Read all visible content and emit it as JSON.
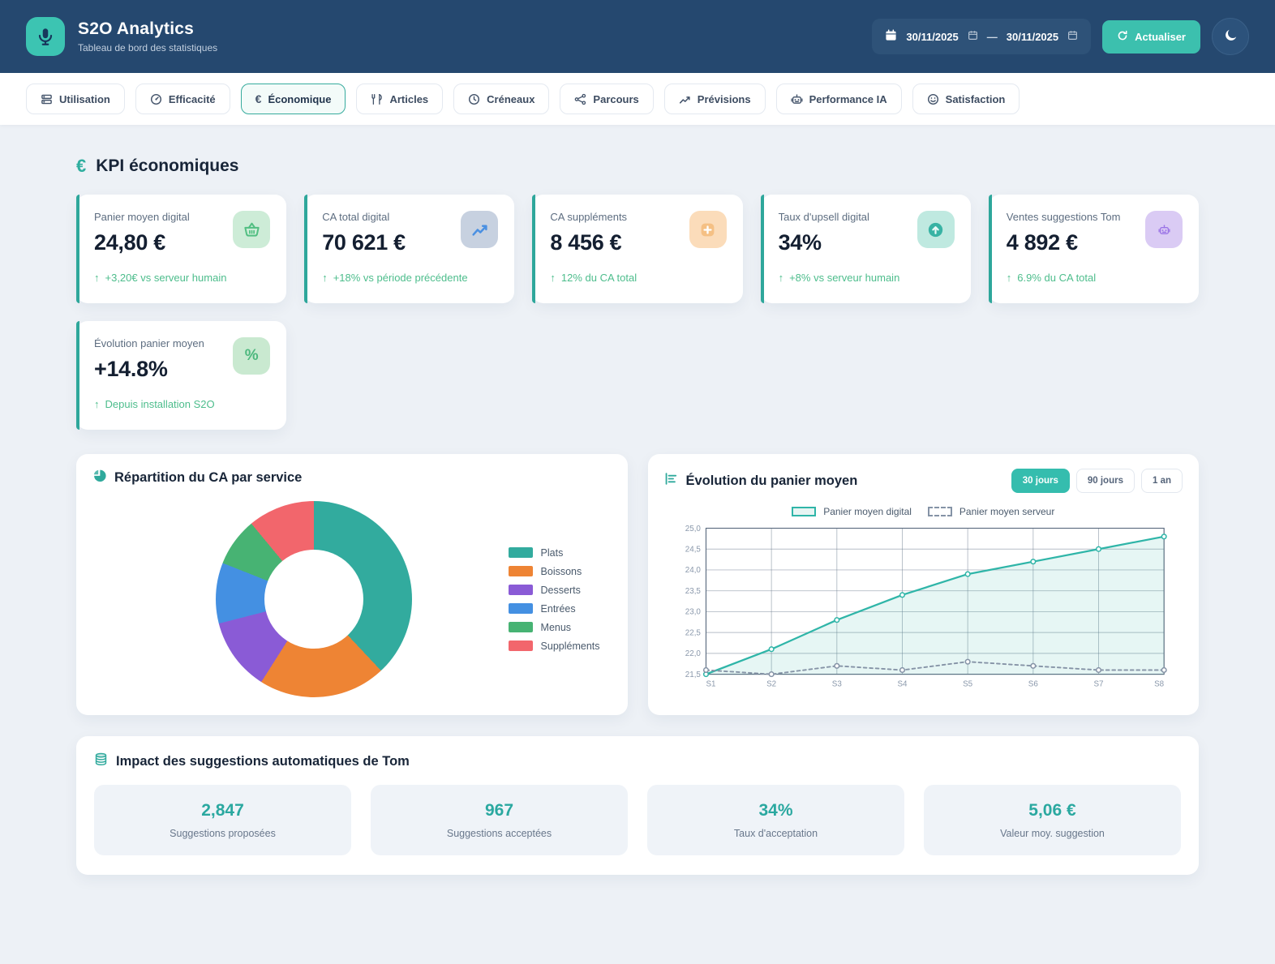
{
  "colors": {
    "accent_teal": "#3cc0ae",
    "header_navy": "#25486f",
    "trend_green": "#4dbd8c",
    "card_stripe": "#2ea79b"
  },
  "header": {
    "app_title": "S2O Analytics",
    "app_subtitle": "Tableau de bord des statistiques",
    "date_from": "30/11/2025",
    "date_separator": "—",
    "date_to": "30/11/2025",
    "refresh_label": "Actualiser"
  },
  "tabs": [
    {
      "label": "Utilisation",
      "icon": "server-icon",
      "active": false
    },
    {
      "label": "Efficacité",
      "icon": "gauge-icon",
      "active": false
    },
    {
      "label": "Économique",
      "icon": "euro-icon",
      "active": true
    },
    {
      "label": "Articles",
      "icon": "utensils-icon",
      "active": false
    },
    {
      "label": "Créneaux",
      "icon": "clock-icon",
      "active": false
    },
    {
      "label": "Parcours",
      "icon": "route-icon",
      "active": false
    },
    {
      "label": "Prévisions",
      "icon": "trend-icon",
      "active": false
    },
    {
      "label": "Performance IA",
      "icon": "robot-icon",
      "active": false
    },
    {
      "label": "Satisfaction",
      "icon": "smiley-icon",
      "active": false
    }
  ],
  "kpi_section": {
    "title": "KPI économiques",
    "cards": [
      {
        "label": "Panier moyen digital",
        "value": "24,80 €",
        "trend": "+3,20€ vs serveur humain",
        "icon": "basket-icon",
        "icon_color": "#52bf82",
        "icon_bg": "#cdecd7"
      },
      {
        "label": "CA total digital",
        "value": "70 621 €",
        "trend": "+18% vs période précédente",
        "icon": "chart-line-icon",
        "icon_color": "#4a90e2",
        "icon_bg": "#c7d1e0"
      },
      {
        "label": "CA suppléments",
        "value": "8 456 €",
        "trend": "12% du CA total",
        "icon": "plus-icon",
        "icon_color": "#f0a44e",
        "icon_bg": "#fbdcba"
      },
      {
        "label": "Taux d'upsell digital",
        "value": "34%",
        "trend": "+8% vs serveur humain",
        "icon": "arrow-up-circle-icon",
        "icon_color": "#38b3a4",
        "icon_bg": "#bfe9e0"
      },
      {
        "label": "Ventes suggestions Tom",
        "value": "4 892 €",
        "trend": "6.9% du CA total",
        "icon": "robot-icon",
        "icon_color": "#9b74e6",
        "icon_bg": "#dacbf4"
      },
      {
        "label": "Évolution panier moyen",
        "value": "+14.8%",
        "trend": "Depuis installation S2O",
        "icon": "percent-icon",
        "icon_color": "#4db87e",
        "icon_bg": "#c9e9d0"
      }
    ]
  },
  "chart_data": [
    {
      "type": "pie",
      "donut": true,
      "title": "Répartition du CA par service",
      "labels": [
        "Plats",
        "Boissons",
        "Desserts",
        "Entrées",
        "Menus",
        "Suppléments"
      ],
      "values": [
        38,
        21,
        12,
        10,
        8,
        11
      ],
      "unit": "percent",
      "colors": [
        "#32ab9e",
        "#ee8434",
        "#8a5bd6",
        "#4490e2",
        "#47b373",
        "#f2666c"
      ],
      "legend_position": "right"
    },
    {
      "type": "line",
      "title": "Évolution du panier moyen",
      "range_buttons": [
        "30 jours",
        "90 jours",
        "1 an"
      ],
      "active_range": "30 jours",
      "x": [
        "S1",
        "S2",
        "S3",
        "S4",
        "S5",
        "S6",
        "S7",
        "S8"
      ],
      "ylim": [
        21.5,
        25.0
      ],
      "ytick_step": 0.5,
      "grid": true,
      "legend_position": "top",
      "series": [
        {
          "name": "Panier moyen digital",
          "values": [
            21.5,
            22.1,
            22.8,
            23.4,
            23.9,
            24.2,
            24.5,
            24.8
          ],
          "color": "#2fb5a8",
          "style": "solid",
          "fill": true
        },
        {
          "name": "Panier moyen serveur",
          "values": [
            21.6,
            21.5,
            21.7,
            21.6,
            21.8,
            21.7,
            21.6,
            21.6
          ],
          "color": "#8593a6",
          "style": "dashed",
          "fill": false
        }
      ]
    }
  ],
  "impact_section": {
    "title": "Impact des suggestions automatiques de Tom",
    "stats": [
      {
        "value": "2,847",
        "label": "Suggestions proposées"
      },
      {
        "value": "967",
        "label": "Suggestions acceptées"
      },
      {
        "value": "34%",
        "label": "Taux d'acceptation"
      },
      {
        "value": "5,06 €",
        "label": "Valeur moy. suggestion"
      }
    ]
  }
}
